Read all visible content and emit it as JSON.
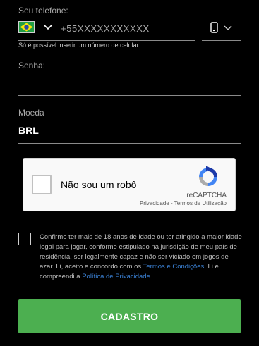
{
  "phone": {
    "label": "Seu telefone:",
    "country_flag": "brazil-flag",
    "placeholder": "+55XXXXXXXXXXX",
    "hint": "Só é possível inserir um número de celular.",
    "type_icon": "mobile-phone-icon"
  },
  "password": {
    "label": "Senha:",
    "value": ""
  },
  "currency": {
    "label": "Moeda",
    "value": "BRL"
  },
  "recaptcha": {
    "label": "Não sou um robô",
    "brand": "reCAPTCHA",
    "privacy": "Privacidade",
    "separator": " - ",
    "terms": "Termos de Utilização"
  },
  "terms": {
    "text_before": "Confirmo ter mais de 18 anos de idade ou ter atingido a maior idade legal para jogar, conforme estipulado na jurisdição de meu país de residência, ser legalmente capaz e não ser viciado em jogos de azar. Li, aceito e concordo com os ",
    "terms_link": "Termos e Condições",
    "text_middle": ". Li e compreendi a ",
    "privacy_link": "Política de Privacidade",
    "text_after": "."
  },
  "submit": {
    "label": "CADASTRO"
  },
  "colors": {
    "background": "#000000",
    "accent_green": "#4caf50",
    "link_blue": "#3b82d6"
  }
}
